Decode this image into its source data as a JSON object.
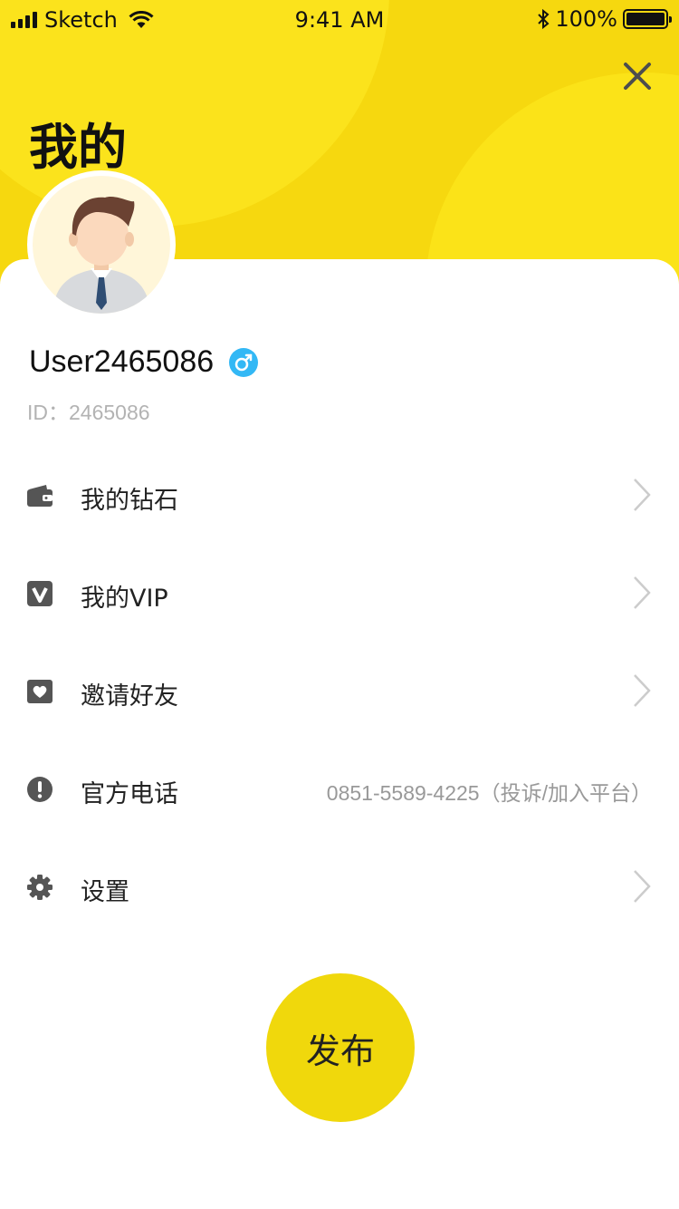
{
  "status_bar": {
    "carrier": "Sketch",
    "time": "9:41 AM",
    "battery_text": "100%"
  },
  "header": {
    "title": "我的",
    "close_icon": "close-icon"
  },
  "profile": {
    "username": "User2465086",
    "gender_icon": "male-icon",
    "id_text": "ID：2465086"
  },
  "menu": {
    "items": [
      {
        "label": "我的钻石",
        "icon": "wallet-icon"
      },
      {
        "label": "我的VIP",
        "icon": "vip-icon"
      },
      {
        "label": "邀请好友",
        "icon": "invite-icon"
      },
      {
        "label": "官方电话",
        "icon": "exclamation-icon",
        "value": "0851-5589-4225（投诉/加入平台）"
      },
      {
        "label": "设置",
        "icon": "gear-icon"
      }
    ]
  },
  "publish": {
    "label": "发布"
  },
  "colors": {
    "header_yellow": "#f6d80f",
    "publish_yellow": "#f0d80c",
    "gender_blue": "#33b8f5"
  }
}
